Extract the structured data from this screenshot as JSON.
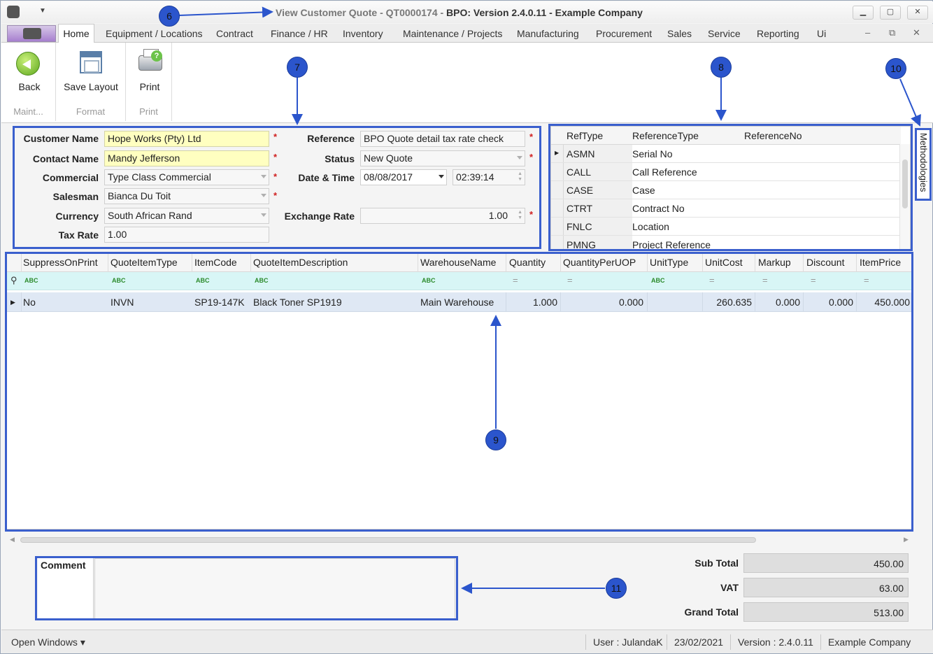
{
  "window": {
    "title_prefix": "View Customer Quote - QT0000174 - ",
    "title_main": "BPO: Version 2.4.0.11 - Example Company",
    "min_label": "▁",
    "max_label": "▢",
    "close_label": "✕"
  },
  "menu": {
    "home": "Home",
    "items": [
      "Equipment / Locations",
      "Contract",
      "Finance / HR",
      "Inventory",
      "Maintenance / Projects",
      "Manufacturing",
      "Procurement",
      "Sales",
      "Service",
      "Reporting",
      "Ui"
    ],
    "mdi_min": "–",
    "mdi_restore": "⧉",
    "mdi_close": "✕"
  },
  "ribbon": {
    "back": "Back",
    "save_layout": "Save Layout",
    "print": "Print",
    "group_maint": "Maint...",
    "group_format": "Format",
    "group_print": "Print"
  },
  "form": {
    "customer_name_label": "Customer Name",
    "customer_name": "Hope Works (Pty) Ltd",
    "contact_name_label": "Contact Name",
    "contact_name": "Mandy Jefferson",
    "commercial_label": "Commercial",
    "commercial": "Type Class Commercial",
    "salesman_label": "Salesman",
    "salesman": "Bianca Du Toit",
    "currency_label": "Currency",
    "currency": "South African Rand",
    "tax_rate_label": "Tax Rate",
    "tax_rate": "1.00",
    "reference_label": "Reference",
    "reference": "BPO Quote detail tax rate check",
    "status_label": "Status",
    "status": "New Quote",
    "datetime_label": "Date & Time",
    "date": "08/08/2017",
    "time": "02:39:14",
    "exchange_rate_label": "Exchange Rate",
    "exchange_rate": "1.00",
    "required_mark": "*"
  },
  "references": {
    "headers": [
      "RefType",
      "ReferenceType",
      "ReferenceNo"
    ],
    "rows": [
      [
        "ASMN",
        "Serial No",
        ""
      ],
      [
        "CALL",
        "Call Reference",
        ""
      ],
      [
        "CASE",
        "Case",
        ""
      ],
      [
        "CTRT",
        "Contract No",
        ""
      ],
      [
        "FNLC",
        "Location",
        ""
      ],
      [
        "PMNG",
        "Project Reference",
        ""
      ]
    ]
  },
  "items": {
    "headers": [
      "SuppressOnPrint",
      "QuoteItemType",
      "ItemCode",
      "QuoteItemDescription",
      "WarehouseName",
      "Quantity",
      "QuantityPerUOP",
      "UnitType",
      "UnitCost",
      "Markup",
      "Discount",
      "ItemPrice"
    ],
    "rows": [
      [
        "No",
        "INVN",
        "SP19-147K",
        "Black Toner SP1919",
        "Main Warehouse",
        "1.000",
        "0.000",
        "",
        "260.635",
        "0.000",
        "0.000",
        "450.000"
      ]
    ]
  },
  "comment": {
    "label": "Comment",
    "value": ""
  },
  "totals": {
    "sub_total_label": "Sub Total",
    "sub_total": "450.00",
    "vat_label": "VAT",
    "vat": "63.00",
    "grand_total_label": "Grand Total",
    "grand_total": "513.00"
  },
  "sidetab": {
    "label": "Methodologies"
  },
  "callouts": {
    "c6": "6",
    "c7": "7",
    "c8": "8",
    "c9": "9",
    "c10": "10",
    "c11": "11"
  },
  "status": {
    "open_windows": "Open Windows ▾",
    "user": "User : JulandaK",
    "date": "23/02/2021",
    "version": "Version : 2.4.0.11",
    "company": "Example Company"
  },
  "colors": {
    "annotation": "#3a5fcd",
    "required_field": "#ffffc0",
    "filter_row": "#d8f6f6",
    "selected_row": "#dfe8f4"
  }
}
